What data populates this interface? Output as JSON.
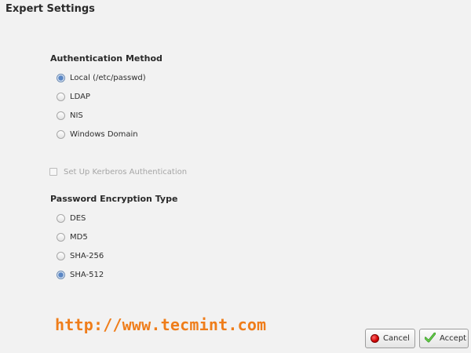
{
  "window": {
    "title": "Expert Settings"
  },
  "authentication": {
    "heading": "Authentication Method",
    "options": [
      {
        "label": "Local (/etc/passwd)",
        "selected": true
      },
      {
        "label": "LDAP",
        "selected": false
      },
      {
        "label": "NIS",
        "selected": false
      },
      {
        "label": "Windows Domain",
        "selected": false
      }
    ]
  },
  "kerberos": {
    "label": "Set Up Kerberos Authentication",
    "checked": false,
    "enabled": false
  },
  "encryption": {
    "heading": "Password Encryption Type",
    "options": [
      {
        "label": "DES",
        "selected": false
      },
      {
        "label": "MD5",
        "selected": false
      },
      {
        "label": "SHA-256",
        "selected": false
      },
      {
        "label": "SHA-512",
        "selected": true
      }
    ]
  },
  "watermark": {
    "text": "http://www.tecmint.com"
  },
  "buttons": {
    "cancel_label": "Cancel",
    "accept_label": "Accept"
  },
  "colors": {
    "watermark": "#ef7d1a",
    "radio_selected": "#5a86c4",
    "cancel_icon": "#d10000",
    "accept_icon": "#3fae2a"
  },
  "icons": {
    "cancel": "cancel-icon",
    "accept": "checkmark-icon"
  }
}
